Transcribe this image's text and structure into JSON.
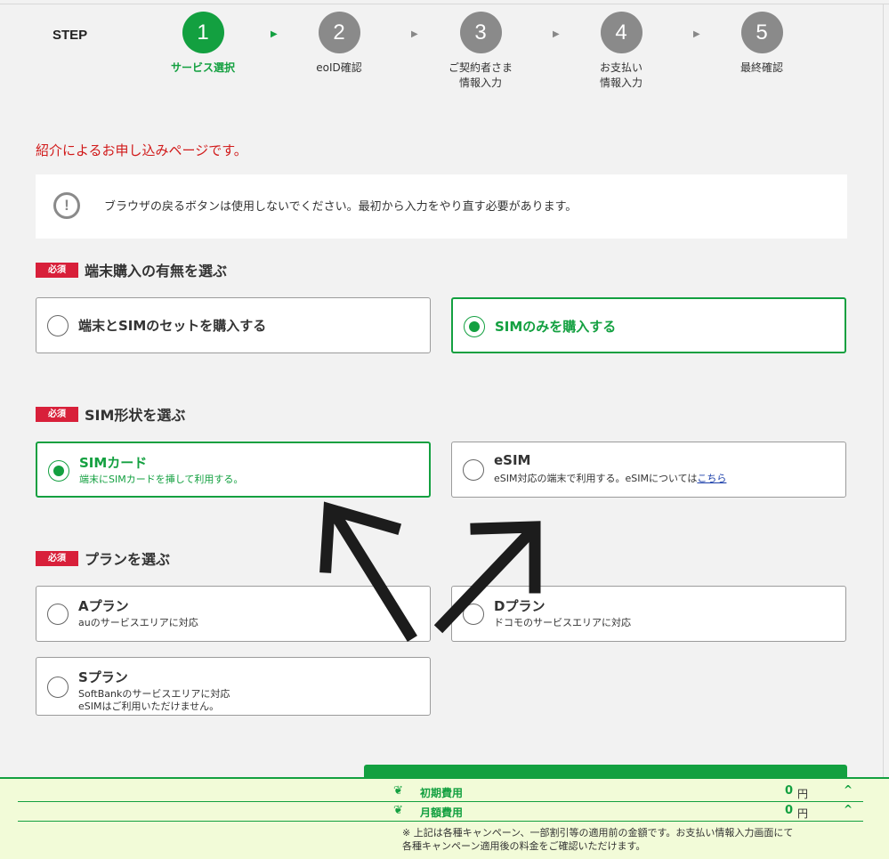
{
  "steps": {
    "label": "STEP",
    "items": [
      {
        "num": "1",
        "caption": "サービス選択"
      },
      {
        "num": "2",
        "caption": "eoID確認"
      },
      {
        "num": "3",
        "caption": "ご契約者さま\n情報入力"
      },
      {
        "num": "4",
        "caption": "お支払い\n情報入力"
      },
      {
        "num": "5",
        "caption": "最終確認"
      }
    ],
    "arrow": "▶"
  },
  "referral_text": "紹介によるお申し込みページです。",
  "notice": {
    "icon": "!",
    "text": "ブラウザの戻るボタンは使用しないでください。最初から入力をやり直す必要があります。"
  },
  "required_badge": "必須",
  "sections": {
    "device": {
      "title": "端末購入の有無を選ぶ",
      "options": [
        {
          "title": "端末とSIMのセットを購入する",
          "selected": false
        },
        {
          "title": "SIMのみを購入する",
          "selected": true
        }
      ]
    },
    "sim_type": {
      "title": "SIM形状を選ぶ",
      "options": [
        {
          "title": "SIMカード",
          "sub": "端末にSIMカードを挿して利用する。",
          "selected": true
        },
        {
          "title": "eSIM",
          "sub": "eSIM対応の端末で利用する。eSIMについては",
          "link": "こちら",
          "selected": false
        }
      ]
    },
    "plan": {
      "title": "プランを選ぶ",
      "options": [
        {
          "title": "Aプラン",
          "sub": "auのサービスエリアに対応",
          "selected": false
        },
        {
          "title": "Dプラン",
          "sub": "ドコモのサービスエリアに対応",
          "selected": false
        },
        {
          "title": "Sプラン",
          "sub": "SoftBankのサービスエリアに対応\neSIMはご利用いただけません。",
          "selected": false
        }
      ]
    }
  },
  "costs": {
    "initial": {
      "label": "初期費用",
      "amount": "0",
      "unit": "円"
    },
    "monthly": {
      "label": "月額費用",
      "amount": "0",
      "unit": "円"
    },
    "note": "※ 上記は各種キャンペーン、一部割引等の適用前の金額です。お支払い情報入力画面にて各種キャンペーン適用後の料金をご確認いただけます。",
    "leaf_icon": "❦",
    "chevron": "^"
  },
  "colors": {
    "accent": "#13a040",
    "required": "#d8203a",
    "referral": "#d11a1a",
    "link": "#1b3faa",
    "cost_bg": "#f2fbd8"
  }
}
